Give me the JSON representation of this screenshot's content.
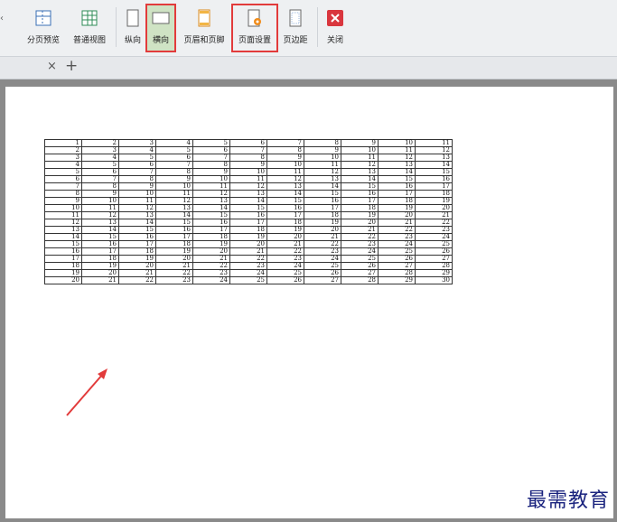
{
  "ribbon": {
    "buttons": [
      {
        "id": "page-break-preview",
        "label": "分页预览",
        "icon": "page-break-preview-icon"
      },
      {
        "id": "normal-view",
        "label": "普通视图",
        "icon": "normal-view-icon"
      },
      {
        "id": "portrait",
        "label": "纵向",
        "icon": "portrait-icon"
      },
      {
        "id": "landscape",
        "label": "横向",
        "icon": "landscape-icon"
      },
      {
        "id": "header-footer",
        "label": "页眉和页脚",
        "icon": "header-footer-icon"
      },
      {
        "id": "page-setup",
        "label": "页面设置",
        "icon": "page-setup-icon"
      },
      {
        "id": "margins",
        "label": "页边距",
        "icon": "margins-icon"
      },
      {
        "id": "close",
        "label": "关闭",
        "icon": "close-icon"
      }
    ],
    "highlighted": [
      "landscape",
      "page-setup"
    ],
    "accent_colors": {
      "highlight": "#e23b3b",
      "close": "#d9363e",
      "icon_blue": "#3a6fb5"
    }
  },
  "tabs": {
    "close_glyph": "×",
    "add_glyph": "+"
  },
  "sheet": {
    "start_values": [
      1,
      2,
      3,
      4,
      5,
      6,
      7,
      8,
      9,
      10,
      11,
      12,
      13,
      14,
      15,
      16,
      17,
      18,
      19,
      20
    ],
    "columns": 11
  },
  "annotation": {
    "arrow_color": "#e23b3b"
  },
  "watermark": "最需教育"
}
